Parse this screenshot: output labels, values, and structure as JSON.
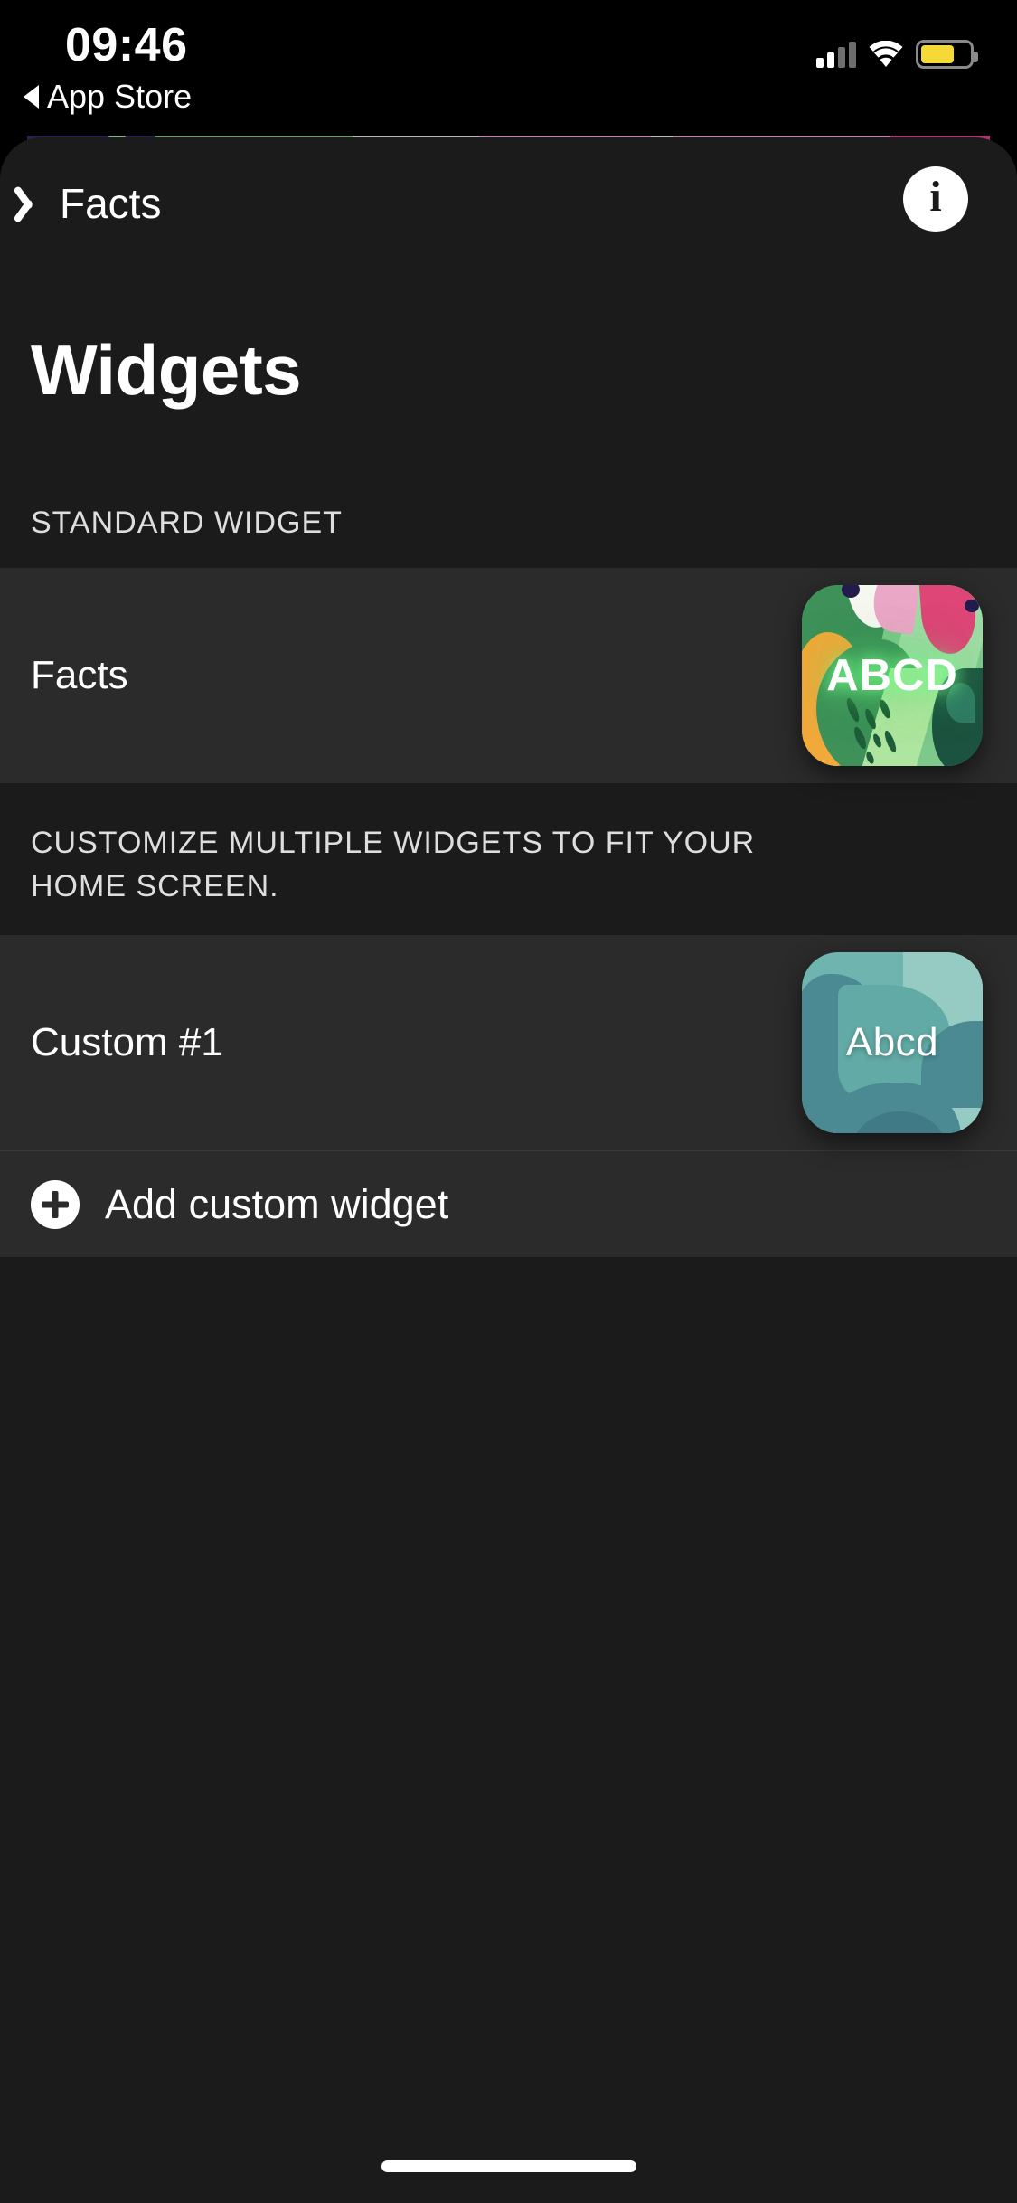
{
  "status_bar": {
    "time": "09:46",
    "signal_icon": "cellular-signal-icon",
    "wifi_icon": "wifi-icon",
    "battery_icon": "battery-icon",
    "battery_color": "#f5d936"
  },
  "return_to_app": {
    "label": "App Store",
    "icon": "back-triangle-icon"
  },
  "nav_bar": {
    "back_label": "Facts",
    "back_icon": "chevron-left-icon",
    "info_icon": "info-circle-icon",
    "info_glyph": "i"
  },
  "page": {
    "title": "Widgets",
    "background": "#1b1b1b",
    "row_background": "#2b2b2b"
  },
  "standard_section": {
    "header": "STANDARD WIDGET",
    "row": {
      "label": "Facts",
      "preview_text": "ABCD",
      "preview_name": "facts-widget-preview"
    }
  },
  "custom_section": {
    "footer": "CUSTOMIZE MULTIPLE WIDGETS TO FIT YOUR HOME SCREEN.",
    "row": {
      "label": "Custom #1",
      "preview_text": "Abcd",
      "preview_name": "custom-widget-preview"
    },
    "add_row": {
      "label": "Add custom widget",
      "icon": "plus-circle-icon"
    }
  },
  "home_indicator": "home-indicator"
}
